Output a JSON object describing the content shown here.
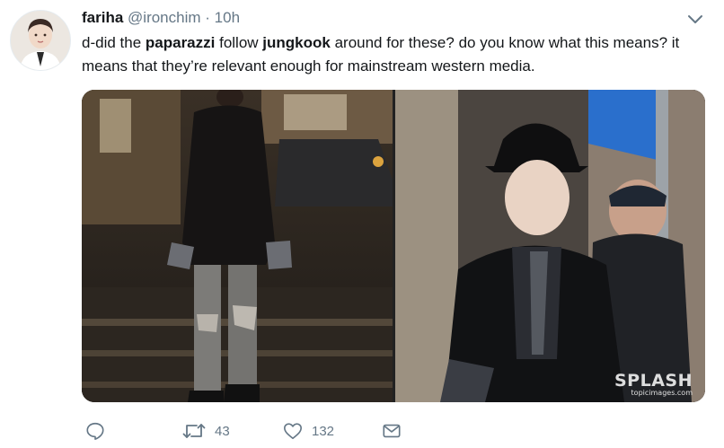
{
  "tweet": {
    "name": "fariha",
    "handle": "@ironchim",
    "separator": "·",
    "time": "10h",
    "text": {
      "t1": "d-did the ",
      "b1": "paparazzi",
      "t2": " follow ",
      "b2": "jungkook",
      "t3": " around for these? do you know what this means? it means that they’re relevant enough for mainstream western media."
    },
    "watermark": {
      "brand": "SPLASH",
      "site": "topicimages.com"
    },
    "actions": {
      "retweets": "43",
      "likes": "132"
    }
  },
  "colors": {
    "text": "#14171a",
    "secondary": "#657786"
  },
  "icons": {
    "caret": "chevron-down-icon",
    "reply": "reply-icon",
    "retweet": "retweet-icon",
    "like": "heart-icon",
    "dm": "envelope-icon"
  }
}
